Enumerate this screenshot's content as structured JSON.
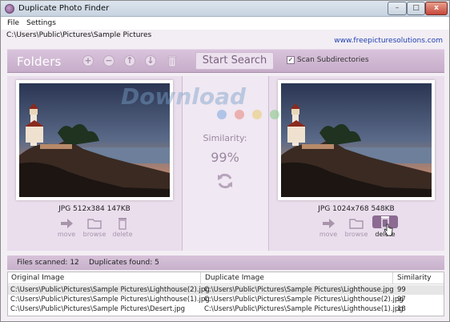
{
  "window": {
    "title": "Duplicate Photo Finder",
    "min_label": "–",
    "max_label": "□",
    "close_label": "x"
  },
  "menu": {
    "items": [
      "File",
      "Settings"
    ]
  },
  "path": "C:\\Users\\Public\\Pictures\\Sample Pictures",
  "site_link": "www.freepicturesolutions.com",
  "toolbar": {
    "folders_label": "Folders",
    "start_label": "Start Search",
    "scan_label": "Scan Subdirectories",
    "scan_checked": true,
    "check_mark": "✓",
    "add_glyph": "+",
    "remove_glyph": "−",
    "up_glyph": "↑",
    "down_glyph": "↓"
  },
  "left_image": {
    "info": "JPG 512x384 147KB",
    "actions": [
      "move",
      "browse",
      "delete"
    ]
  },
  "right_image": {
    "info": "JPG 1024x768 548KB",
    "actions": [
      "move",
      "browse",
      "delete"
    ]
  },
  "similarity": {
    "label": "Similarity:",
    "value": "99%"
  },
  "watermark": "Download",
  "stats": {
    "files_scanned": "Files scanned: 12",
    "duplicates_found": "Duplicates found: 5"
  },
  "table": {
    "headers": [
      "Original Image",
      "Duplicate Image",
      "Similarity"
    ],
    "rows": [
      [
        "C:\\Users\\Public\\Pictures\\Sample Pictures\\Lighthouse(2).jpg",
        "C:\\Users\\Public\\Pictures\\Sample Pictures\\Lighthouse.jpg",
        "99"
      ],
      [
        "C:\\Users\\Public\\Pictures\\Sample Pictures\\Lighthouse(1).jpg",
        "C:\\Users\\Public\\Pictures\\Sample Pictures\\Lighthouse(2).jpg",
        "97"
      ],
      [
        "C:\\Users\\Public\\Pictures\\Sample Pictures\\Desert.jpg",
        "C:\\Users\\Public\\Pictures\\Sample Pictures\\Lighthouse(1).jpg",
        "18"
      ]
    ]
  },
  "colors": {
    "accent": "#c6acc9",
    "link": "#1f3fb0",
    "highlight_button": "#8c6a92"
  }
}
